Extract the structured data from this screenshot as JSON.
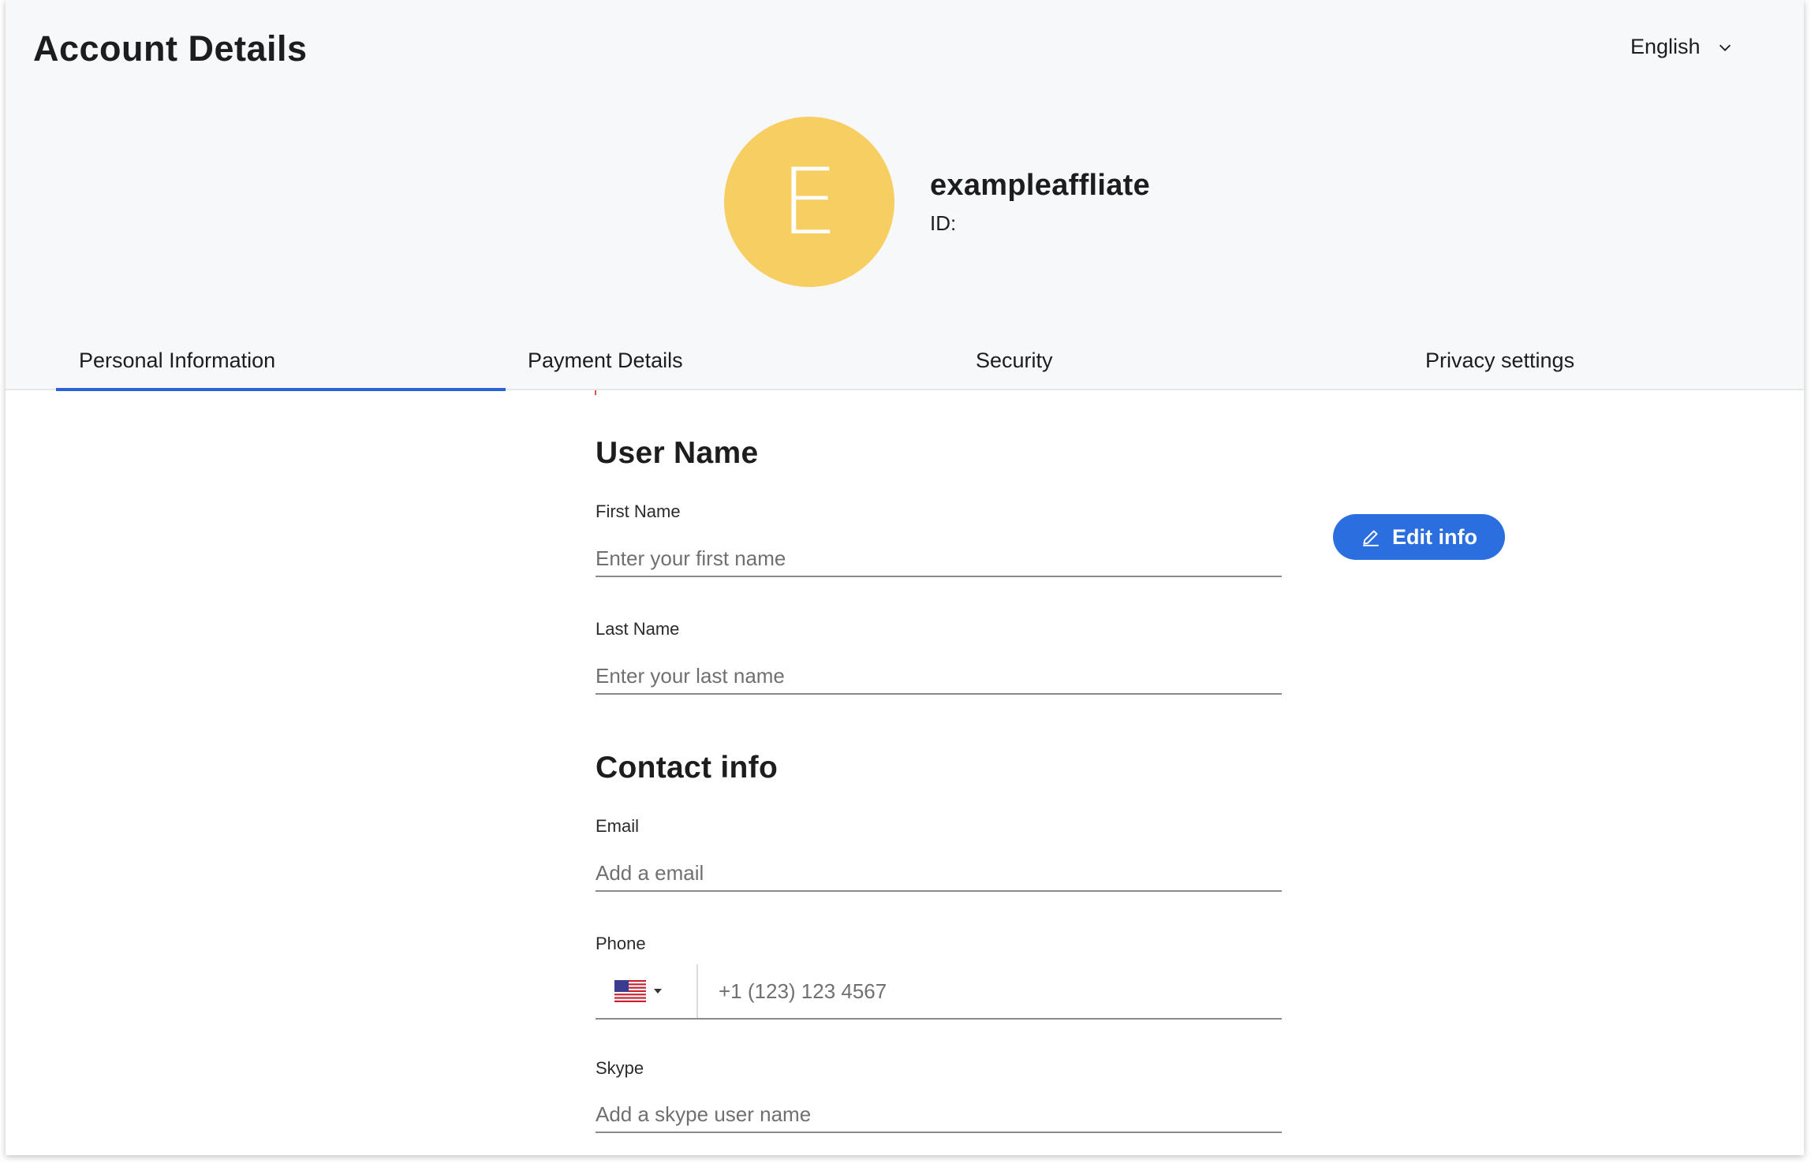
{
  "header": {
    "title": "Account Details",
    "language": "English"
  },
  "profile": {
    "avatar_letter": "E",
    "avatar_color": "#f7ce62",
    "username": "exampleaffliate",
    "id_label": "ID:"
  },
  "tabs": [
    {
      "label": "Personal Information",
      "active": true
    },
    {
      "label": "Payment Details",
      "active": false
    },
    {
      "label": "Security",
      "active": false
    },
    {
      "label": "Privacy settings",
      "active": false
    }
  ],
  "accent_color": "#2a62d6",
  "user_name_section": {
    "title": "User Name",
    "first_name": {
      "label": "First Name",
      "value": "",
      "placeholder": "Enter your first name"
    },
    "last_name": {
      "label": "Last Name",
      "value": "",
      "placeholder": "Enter your last name"
    }
  },
  "contact_section": {
    "title": "Contact info",
    "email": {
      "label": "Email",
      "value": "",
      "placeholder": "Add a email"
    },
    "phone": {
      "label": "Phone",
      "country": "US",
      "value": "",
      "placeholder": "+1 (123) 123 4567"
    },
    "skype": {
      "label": "Skype",
      "value": "",
      "placeholder": "Add a skype user name"
    }
  },
  "edit_button": {
    "label": "Edit info",
    "icon": "pencil-icon",
    "color": "#2a6ee0"
  }
}
